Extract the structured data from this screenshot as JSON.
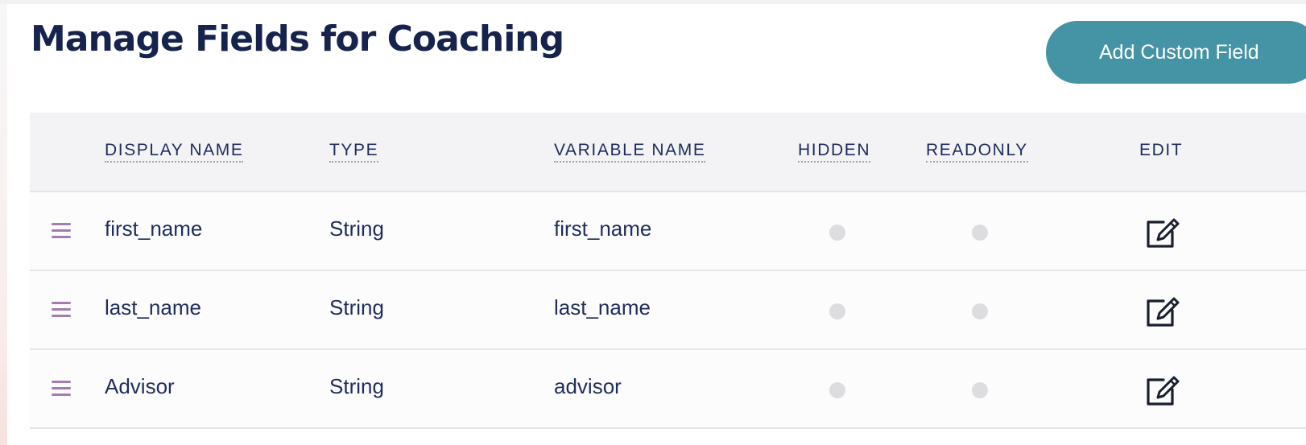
{
  "page": {
    "title": "Manage Fields for Coaching",
    "add_button_label": "Add Custom Field"
  },
  "table": {
    "headers": {
      "display_name": "DISPLAY NAME",
      "type": "TYPE",
      "variable_name": "VARIABLE NAME",
      "hidden": "HIDDEN",
      "readonly": "READONLY",
      "edit": "EDIT"
    },
    "rows": [
      {
        "display_name": "first_name",
        "type": "String",
        "variable_name": "first_name",
        "hidden": false,
        "readonly": false
      },
      {
        "display_name": "last_name",
        "type": "String",
        "variable_name": "last_name",
        "hidden": false,
        "readonly": false
      },
      {
        "display_name": "Advisor",
        "type": "String",
        "variable_name": "advisor",
        "hidden": false,
        "readonly": false
      }
    ]
  },
  "icons": {
    "row_handle": "drag-handle-icon",
    "row_edit": "edit-icon"
  },
  "colors": {
    "title_text": "#16234d",
    "accent_button": "#4494a5",
    "drag_handle": "#a47db0",
    "toggle_off": "#dddddf",
    "header_background": "#f3f3f5"
  }
}
